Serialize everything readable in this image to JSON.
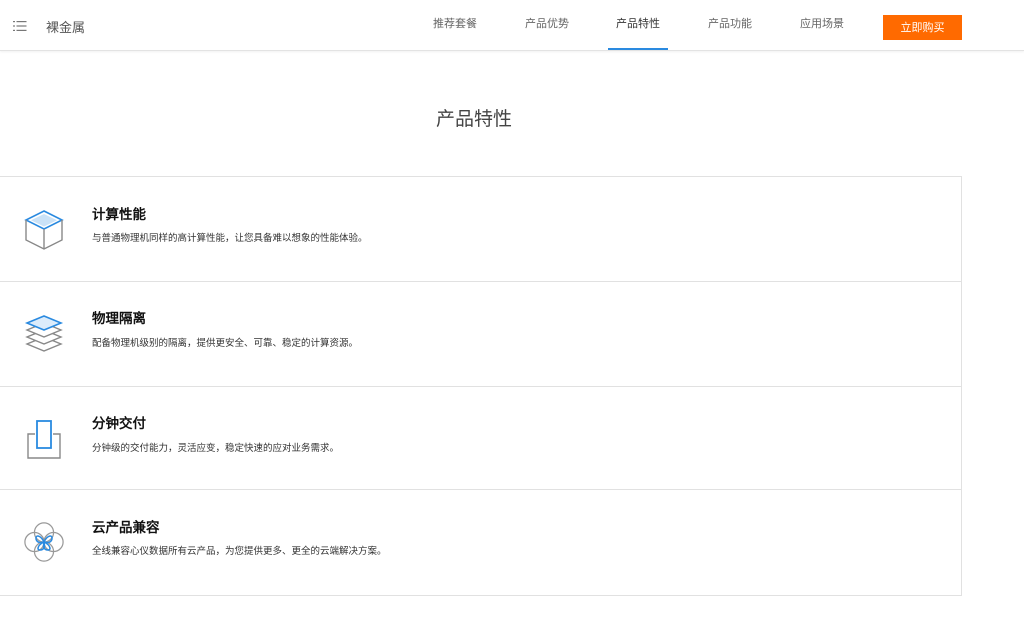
{
  "header": {
    "brand": "裸金属",
    "menu_icon": "list-icon",
    "nav": [
      {
        "label": "推荐套餐",
        "active": false
      },
      {
        "label": "产品优势",
        "active": false
      },
      {
        "label": "产品特性",
        "active": true
      },
      {
        "label": "产品功能",
        "active": false
      },
      {
        "label": "应用场景",
        "active": false
      }
    ],
    "buy_label": "立即购买",
    "accent_color": "#2a8ae0",
    "buy_color": "#ff6a00"
  },
  "main": {
    "title": "产品特性",
    "features": [
      {
        "icon": "cube-icon",
        "title": "计算性能",
        "desc": "与普通物理机同样的高计算性能，让您具备难以想象的性能体验。"
      },
      {
        "icon": "layers-icon",
        "title": "物理隔离",
        "desc": "配备物理机级别的隔离，提供更安全、可靠、稳定的计算资源。"
      },
      {
        "icon": "device-tray-icon",
        "title": "分钟交付",
        "desc": "分钟级的交付能力，灵活应变，稳定快速的应对业务需求。"
      },
      {
        "icon": "clover-icon",
        "title": "云产品兼容",
        "desc": "全线兼容心仪数据所有云产品，为您提供更多、更全的云端解决方案。"
      }
    ]
  }
}
